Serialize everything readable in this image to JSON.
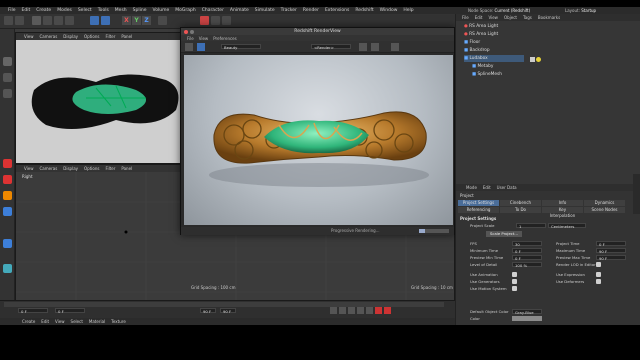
{
  "menubar": [
    "File",
    "Edit",
    "Create",
    "Modes",
    "Select",
    "Tools",
    "Mesh",
    "Spline",
    "Volume",
    "MoGraph",
    "Character",
    "Animate",
    "Simulate",
    "Tracker",
    "Render",
    "Extensions",
    "Redshift",
    "Window",
    "Help"
  ],
  "node_space": "Node Space:",
  "node_space_value": "Current (Redshift)",
  "layout_label": "Layout:",
  "layout_value": "Startup",
  "viewport_menu": [
    "View",
    "Cameras",
    "Display",
    "Options",
    "Filter",
    "Panel"
  ],
  "viewport2_menu": [
    "View",
    "Cameras",
    "Display",
    "Options",
    "Filter",
    "Panel"
  ],
  "viewport2_label": "Right",
  "grid_spacing_a": "Grid Spacing : 100 cm",
  "grid_spacing_b": "Grid Spacing : 10 cm",
  "renderview": {
    "title": "Redshift RenderView",
    "menu": [
      "File",
      "View",
      "Preferences"
    ],
    "dropdown_a": "Beauty",
    "dropdown_b": "<Render>",
    "status": "Progressive Rendering..."
  },
  "object_manager": {
    "tabs": [
      "File",
      "Edit",
      "View",
      "Object",
      "Tags",
      "Bookmarks"
    ],
    "items": [
      "RS Area Light",
      "RS Area Light",
      "Floor",
      "Backdrop",
      "Ludabox",
      "Metaby",
      "SplineMesh"
    ]
  },
  "attributes": {
    "tabs": [
      "Mode",
      "Edit",
      "User Data"
    ],
    "object_title": "Project",
    "subtabs": [
      "Project Settings",
      "Cinebench",
      "Info",
      "Dynamics",
      "Referencing",
      "To Do",
      "Key Interpolation",
      "Scene Nodes"
    ],
    "section": "Project Settings",
    "project_scale_label": "Project Scale",
    "project_scale_value": "1",
    "project_scale_unit": "Centimeters",
    "scale_button": "Scale Project...",
    "fields": [
      {
        "label": "FPS",
        "value": "30"
      },
      {
        "label": "Minimum Time",
        "value": "0 F"
      },
      {
        "label": "Preview Min Time",
        "value": "0 F"
      },
      {
        "label": "Level of Detail",
        "value": "100 %"
      }
    ],
    "fields_right": [
      {
        "label": "Project Time",
        "value": "0 F"
      },
      {
        "label": "Maximum Time",
        "value": "90 F"
      },
      {
        "label": "Preview Max Time",
        "value": "90 F"
      },
      {
        "label": "Render LOD in Editor",
        "value": ""
      }
    ],
    "checks_left": [
      "Use Animation",
      "Use Generators",
      "Use Motion System"
    ],
    "checks_right": [
      "Use Expression",
      "Use Deformers"
    ],
    "default_color_label": "Default Object Color",
    "default_color_value": "Gray-Blue",
    "color_label": "Color"
  },
  "timeline": {
    "start": "0 F",
    "current": "0 F",
    "end": "90 F",
    "end2": "90 F"
  },
  "material_menu": [
    "Create",
    "Edit",
    "View",
    "Select",
    "Material",
    "Texture"
  ]
}
